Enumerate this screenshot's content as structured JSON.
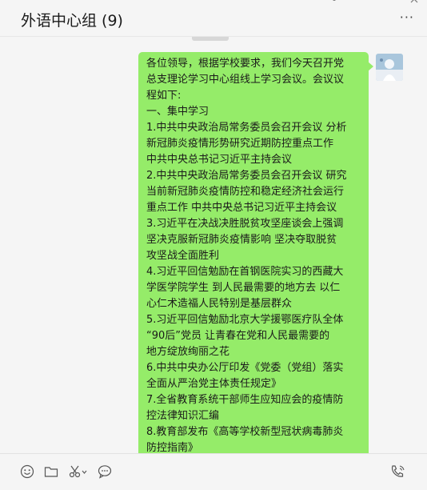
{
  "header": {
    "title": "外语中心组 (9)",
    "more_glyph": "···"
  },
  "message": {
    "lines": [
      "各位领导，根据学校要求，我们今天召开党",
      "总支理论学习中心组线上学习会议。会议议",
      "程如下:",
      "一、集中学习",
      "1.中共中央政治局常务委员会召开会议 分析",
      "新冠肺炎疫情形势研究近期防控重点工作",
      "中共中央总书记习近平主持会议",
      "2.中共中央政治局常务委员会召开会议 研究",
      "当前新冠肺炎疫情防控和稳定经济社会运行",
      "重点工作 中共中央总书记习近平主持会议",
      "3.习近平在决战决胜脱贫攻坚座谈会上强调",
      "坚决克服新冠肺炎疫情影响 坚决夺取脱贫",
      "攻坚战全面胜利",
      "4.习近平回信勉励在首钢医院实习的西藏大",
      "学医学院学生 到人民最需要的地方去 以仁",
      "心仁术造福人民特别是基层群众",
      "5.习近平回信勉励北京大学援鄂医疗队全体",
      "“90后”党员 让青春在党和人民最需要的",
      "地方绽放绚丽之花",
      "6.中共中央办公厅印发《党委（党组）落实",
      "全面从严治党主体责任规定》",
      "7.全省教育系统干部师生应知应会的疫情防",
      "控法律知识汇编",
      "8.教育部发布《高等学校新型冠状病毒肺炎",
      "防控指南》"
    ]
  },
  "toolbar": {
    "icons": [
      "emoji-icon",
      "folder-icon",
      "scissors-icon",
      "chat-bubble-icon",
      "voice-call-icon"
    ]
  },
  "colors": {
    "bubble": "#95ec69",
    "background": "#f5f5f5"
  }
}
